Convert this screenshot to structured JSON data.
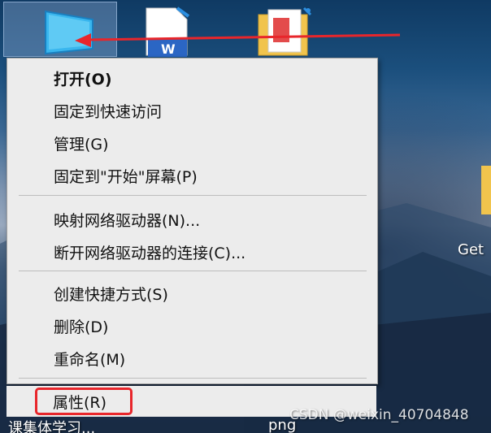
{
  "desktop": {
    "icons": [
      {
        "name": "this-pc",
        "label": "课集体学习..."
      },
      {
        "name": "word-doc",
        "label": "W"
      },
      {
        "name": "folder",
        "label": "png"
      }
    ],
    "right_label": "Get",
    "watermark": "CSDN @weixin_40704848"
  },
  "context_menu": {
    "items": [
      {
        "label": "打开(O)",
        "bold": true
      },
      {
        "label": "固定到快速访问"
      },
      {
        "label": "管理(G)"
      },
      {
        "label": "固定到\"开始\"屏幕(P)"
      },
      {
        "label": "映射网络驱动器(N)..."
      },
      {
        "label": "断开网络驱动器的连接(C)..."
      },
      {
        "label": "创建快捷方式(S)"
      },
      {
        "label": "删除(D)"
      },
      {
        "label": "重命名(M)"
      },
      {
        "label": "属性(R)"
      }
    ]
  },
  "colors": {
    "menu_bg": "#ececec",
    "highlight_border": "#e8262b",
    "arrow": "#e8262b"
  }
}
